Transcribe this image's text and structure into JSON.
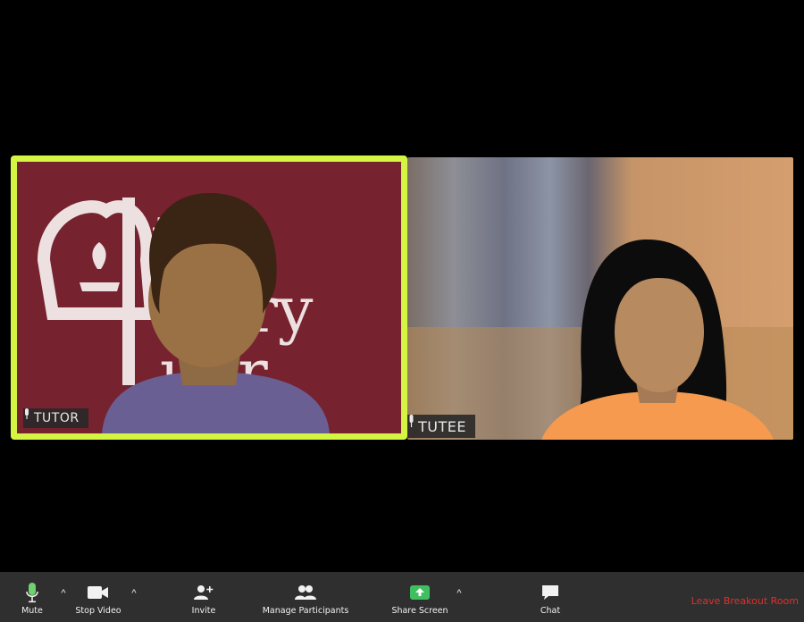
{
  "participants": [
    {
      "name": "TUTOR",
      "role": "active-speaker"
    },
    {
      "name": "TUTEE",
      "role": "participant"
    }
  ],
  "toolbar": {
    "mute_label": "Mute",
    "stop_video_label": "Stop Video",
    "invite_label": "Invite",
    "manage_participants_label": "Manage Participants",
    "share_screen_label": "Share Screen",
    "chat_label": "Chat",
    "leave_label": "Leave Breakout Room"
  },
  "colors": {
    "active_speaker_border": "#d4f542",
    "tutor_background": "#76222f",
    "toolbar": "#2f2f2f",
    "mic_active": "#6fd16f",
    "share_screen": "#3fbf5f",
    "leave": "#e0302a"
  },
  "icons": {
    "mute": "microphone-icon",
    "video": "video-camera-icon",
    "invite": "add-person-icon",
    "participants": "people-icon",
    "share": "share-screen-icon",
    "chat": "chat-bubble-icon"
  }
}
